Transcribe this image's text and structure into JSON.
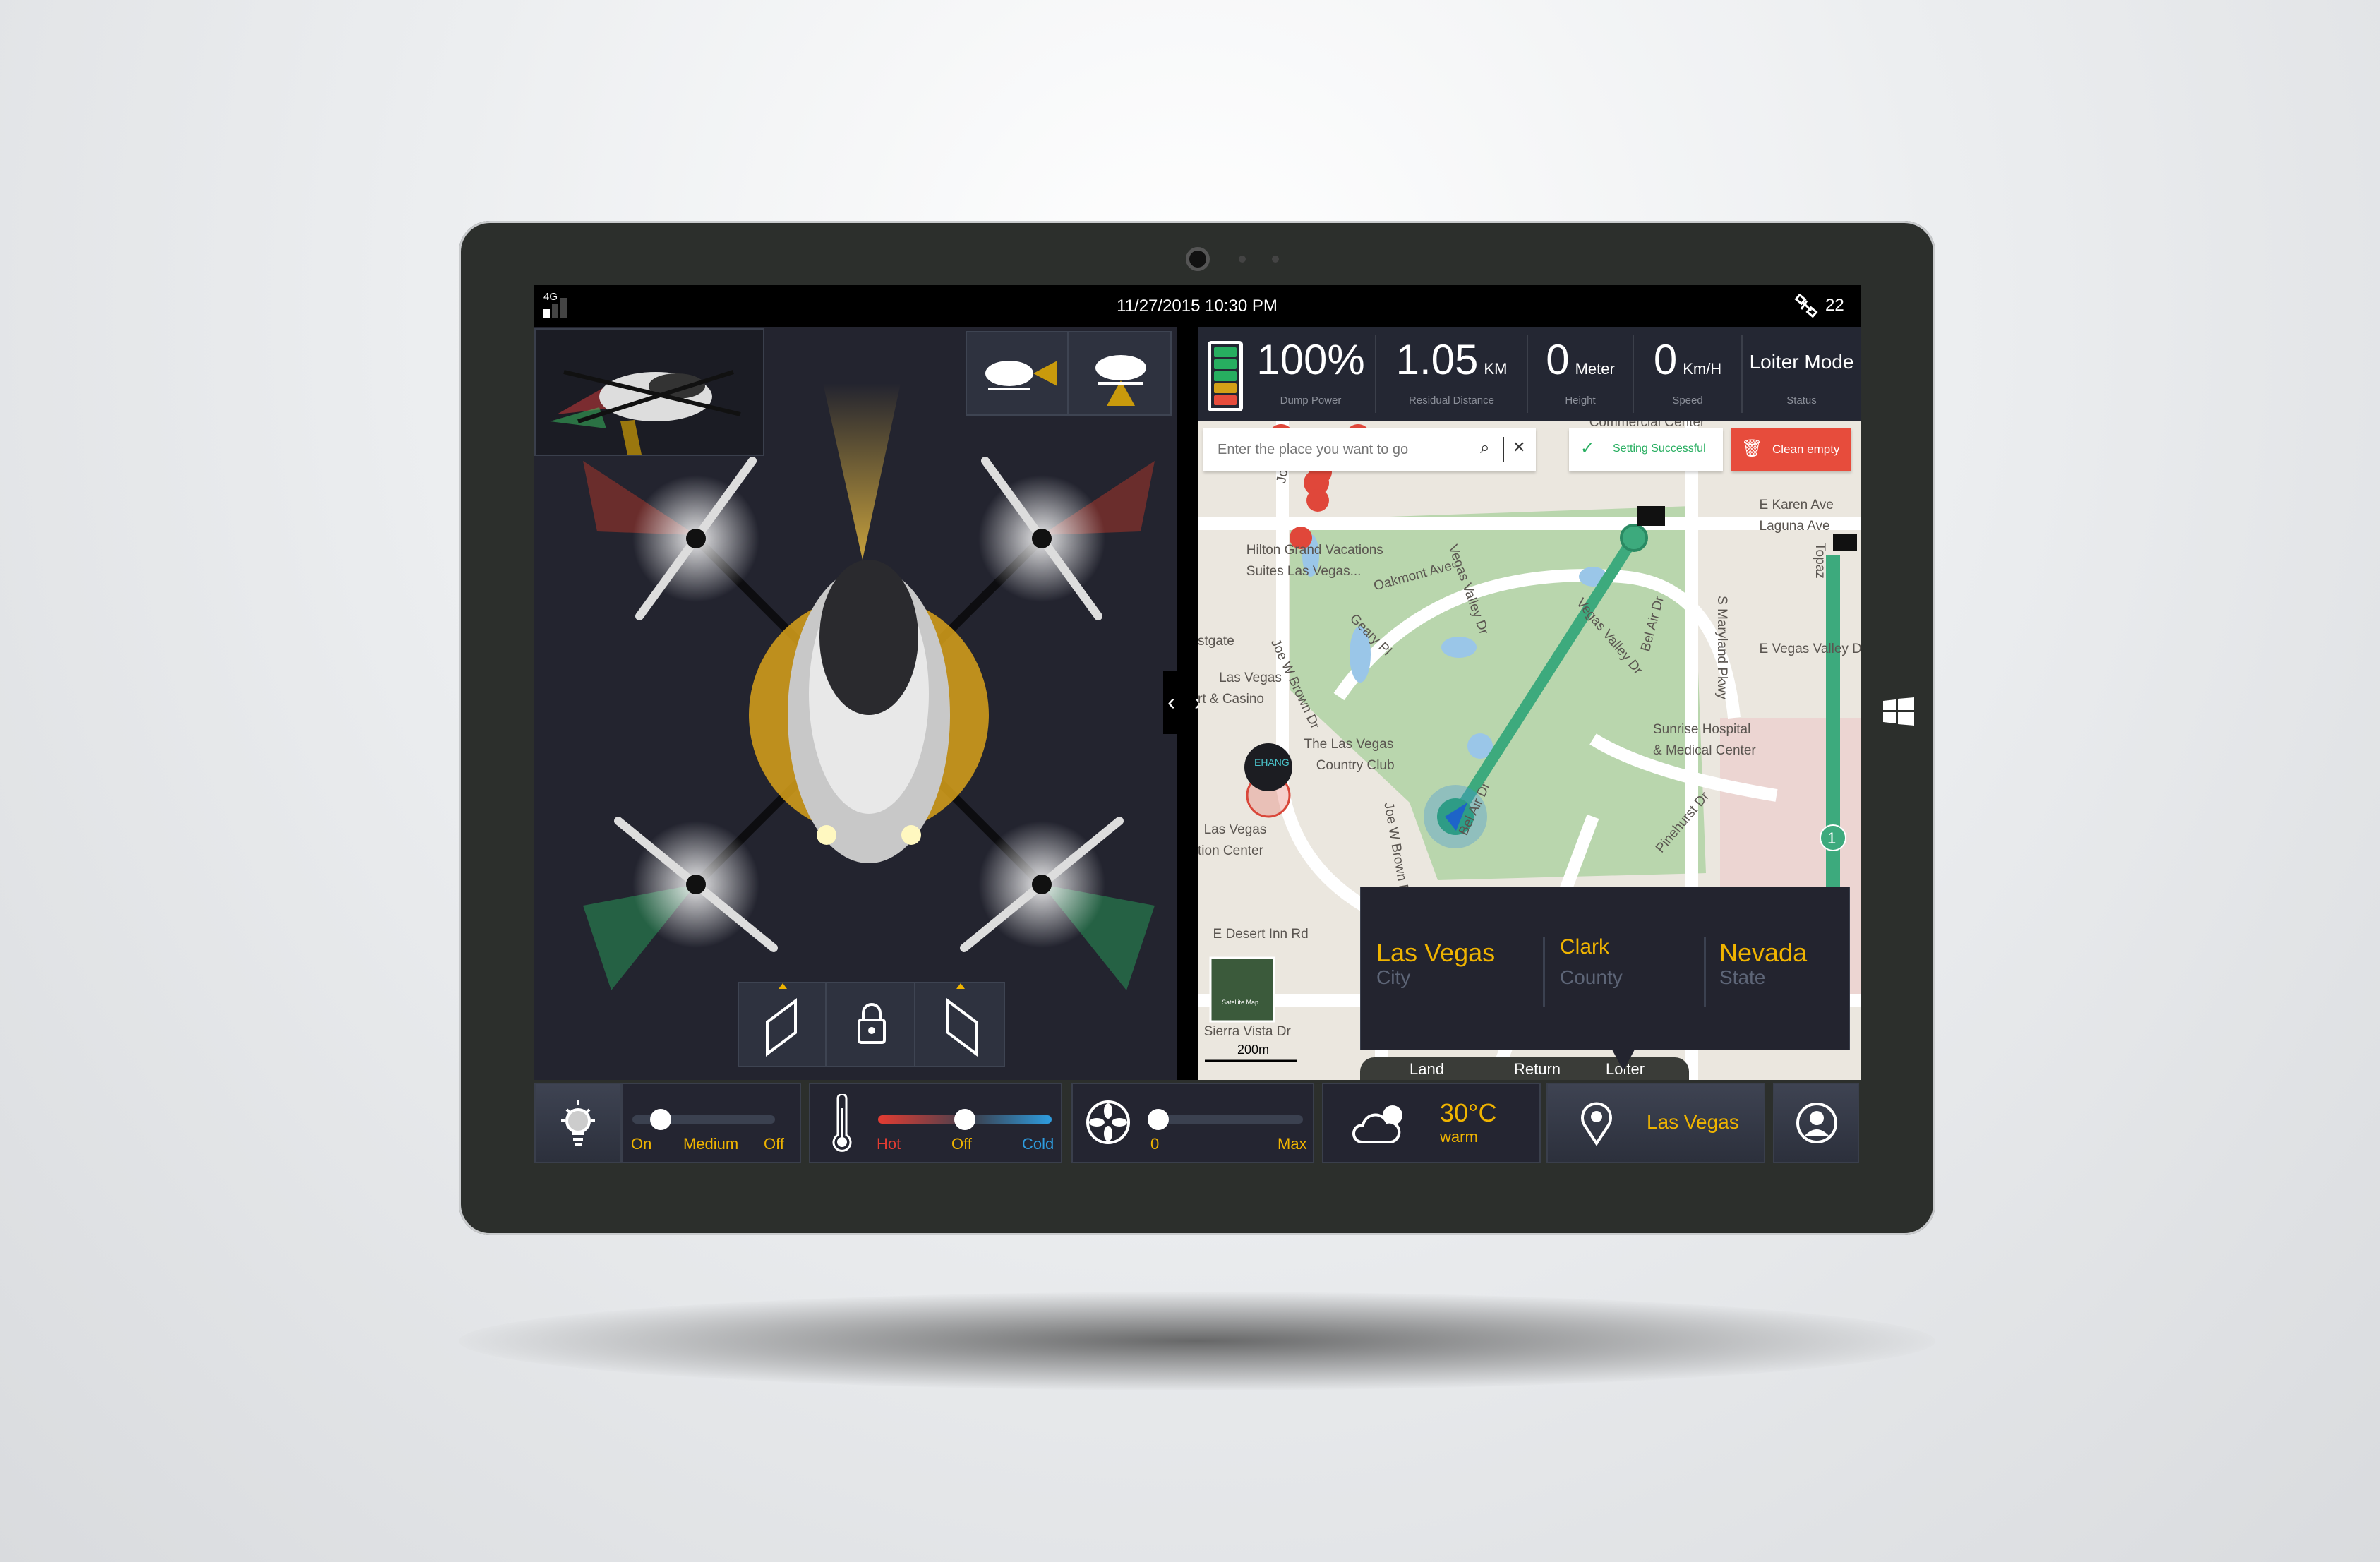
{
  "status_bar": {
    "network": "4G",
    "datetime": "11/27/2015  10:30 PM",
    "satellites": "22",
    "signal_level": 1,
    "signal_max": 3
  },
  "stats": [
    {
      "value": "100%",
      "unit": "",
      "label": "Dump Power"
    },
    {
      "value": "1.05",
      "unit": "KM",
      "label": "Residual Distance"
    },
    {
      "value": "0",
      "unit": "Meter",
      "label": "Height"
    },
    {
      "value": "0",
      "unit": "Km/H",
      "label": "Speed"
    },
    {
      "value": "Loiter Mode",
      "unit": "",
      "label": "Status"
    }
  ],
  "battery": {
    "percent": 100,
    "cell_colors": [
      "#27ae60",
      "#27ae60",
      "#27ae60",
      "#d4a017",
      "#e74c3c"
    ]
  },
  "map": {
    "search_placeholder": "Enter the place you want to go",
    "setting_status": "Setting Successful",
    "clean_label": "Clean empty",
    "labels": [
      "Commercial Center",
      "Hilton Grand Vacations",
      "Suites Las Vegas...",
      "Oakmont Ave",
      "Geary Pl",
      "Vegas Valley Dr",
      "Vegas Valley Dr",
      "Joe W Brown Dr",
      "Joe W Brown Dr",
      "Bel Air Dr",
      "Bel Air Dr",
      "S Maryland Pkwy",
      "E Karen Ave",
      "Laguna Ave",
      "E Vegas Valley Dr",
      "Sunrise Hospital",
      "& Medical Center",
      "The Las Vegas",
      "Country Club",
      "stgate",
      "Las Vegas",
      "rt & Casino",
      "Las Vegas",
      "tion Center",
      "E Desert Inn Rd",
      "Sierra Vista Dr",
      "Pinehurst Dr",
      "Joe W",
      "Topaz"
    ],
    "brand_marker": "EHANG",
    "route_waypoint": "1",
    "scale": "200m",
    "satellite_thumb": "Satellite Map",
    "popup": {
      "city": "Las Vegas",
      "city_label": "City",
      "county": "Clark",
      "county_label": "County",
      "state": "Nevada",
      "state_label": "State"
    },
    "actions": [
      "Land",
      "Return",
      "Loiter"
    ],
    "route_color": "#3daa7d",
    "pin_color": "#e0473a"
  },
  "bottom": {
    "light": {
      "labels": [
        "On",
        "Medium",
        "Off"
      ],
      "value": "On"
    },
    "temperature": {
      "labels": [
        "Hot",
        "Off",
        "Cold"
      ],
      "value": "Off"
    },
    "fan": {
      "labels": [
        "0",
        "Max"
      ],
      "value": 0
    },
    "weather": {
      "temp": "30°C",
      "desc": "warm",
      "icon": "cloud-sun-icon"
    },
    "location": "Las Vegas"
  },
  "colors": {
    "accent": "#f0b400",
    "panel": "#23242f",
    "success": "#27ae60",
    "danger": "#e74c3c",
    "cold": "#2e9de0",
    "hot": "#e43c32"
  }
}
